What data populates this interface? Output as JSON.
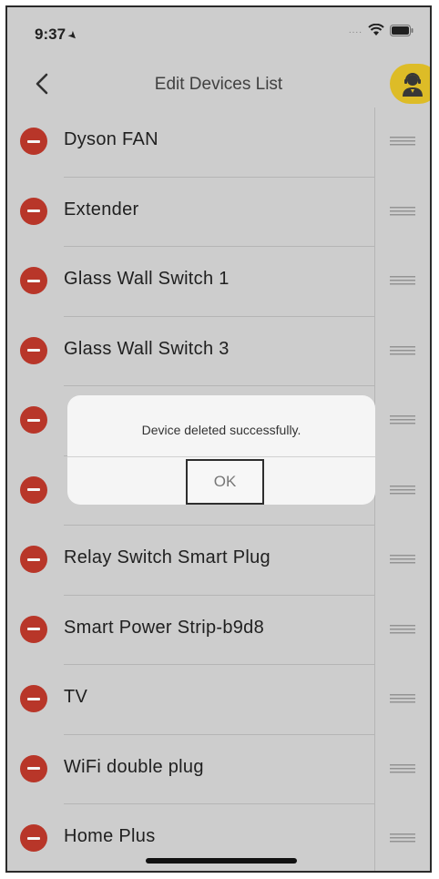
{
  "status_bar": {
    "time": "9:37",
    "location_icon": "location-arrow-icon",
    "dots": "....",
    "wifi_icon": "wifi-icon",
    "battery_icon": "battery-icon"
  },
  "nav": {
    "title": "Edit Devices List",
    "back_icon": "chevron-left-icon",
    "support_icon": "support-agent-icon",
    "support_color": "#e6c429"
  },
  "devices": [
    {
      "name": "Dyson FAN"
    },
    {
      "name": "Extender"
    },
    {
      "name": "Glass Wall Switch 1"
    },
    {
      "name": "Glass Wall Switch 3"
    },
    {
      "name": ""
    },
    {
      "name": ""
    },
    {
      "name": "Relay Switch Smart Plug"
    },
    {
      "name": "Smart Power Strip-b9d8"
    },
    {
      "name": "TV"
    },
    {
      "name": "WiFi double plug"
    },
    {
      "name": "Home Plus"
    }
  ],
  "dialog": {
    "message": "Device deleted successfully.",
    "ok_label": "OK"
  },
  "colors": {
    "delete": "#c0392b",
    "accent": "#e6c429"
  }
}
